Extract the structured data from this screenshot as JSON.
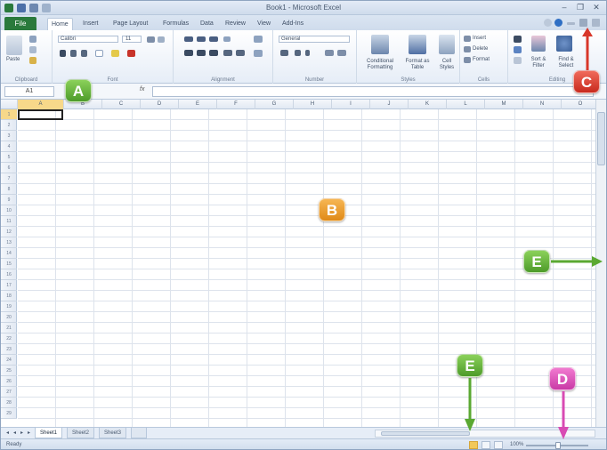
{
  "window": {
    "title": "Book1 - Microsoft Excel"
  },
  "ribbon_tabs": {
    "file": "File",
    "tabs": [
      "Home",
      "Insert",
      "Page Layout",
      "Formulas",
      "Data",
      "Review",
      "View",
      "Add-Ins"
    ]
  },
  "ribbon": {
    "font_name": "Calibri",
    "font_size": "11",
    "number_format": "General",
    "groups": [
      "Clipboard",
      "Font",
      "Alignment",
      "Number",
      "Styles",
      "Cells",
      "Editing"
    ],
    "buttons": {
      "paste": "Paste",
      "conditional": "Conditional Formatting",
      "format_table": "Format as Table",
      "cell_styles": "Cell Styles",
      "insert": "Insert",
      "delete": "Delete",
      "format": "Format",
      "sort": "Sort & Filter",
      "find": "Find & Select"
    }
  },
  "formula_bar": {
    "name_box": "A1",
    "fx": "fx",
    "value": ""
  },
  "columns": [
    "A",
    "B",
    "C",
    "D",
    "E",
    "F",
    "G",
    "H",
    "I",
    "J",
    "K",
    "L",
    "M",
    "N",
    "O"
  ],
  "rows": [
    "1",
    "2",
    "3",
    "4",
    "5",
    "6",
    "7",
    "8",
    "9",
    "10",
    "11",
    "12",
    "13",
    "14",
    "15",
    "16",
    "17",
    "18",
    "19",
    "20",
    "21",
    "22",
    "23",
    "24",
    "25",
    "26",
    "27",
    "28",
    "29"
  ],
  "sheets": [
    "Sheet1",
    "Sheet2",
    "Sheet3"
  ],
  "status": {
    "ready": "Ready",
    "zoom": "100%"
  },
  "callouts": {
    "a": "A",
    "b": "B",
    "c": "C",
    "d": "D",
    "e1": "E",
    "e2": "E"
  },
  "colors": {
    "file_tab": "#2a7a3c",
    "selection": "#f7d88a",
    "callout_green": "#5aa832",
    "callout_orange": "#e8961f",
    "callout_red": "#d8372a",
    "callout_pink": "#d84bb3"
  },
  "icons": [
    "excel-icon",
    "save-icon",
    "undo-icon",
    "redo-icon",
    "help-icon",
    "minimize-icon",
    "restore-icon",
    "close-icon",
    "paste-icon",
    "bold-icon",
    "italic-icon",
    "underline-icon",
    "sum-icon",
    "sort-icon",
    "find-icon"
  ]
}
